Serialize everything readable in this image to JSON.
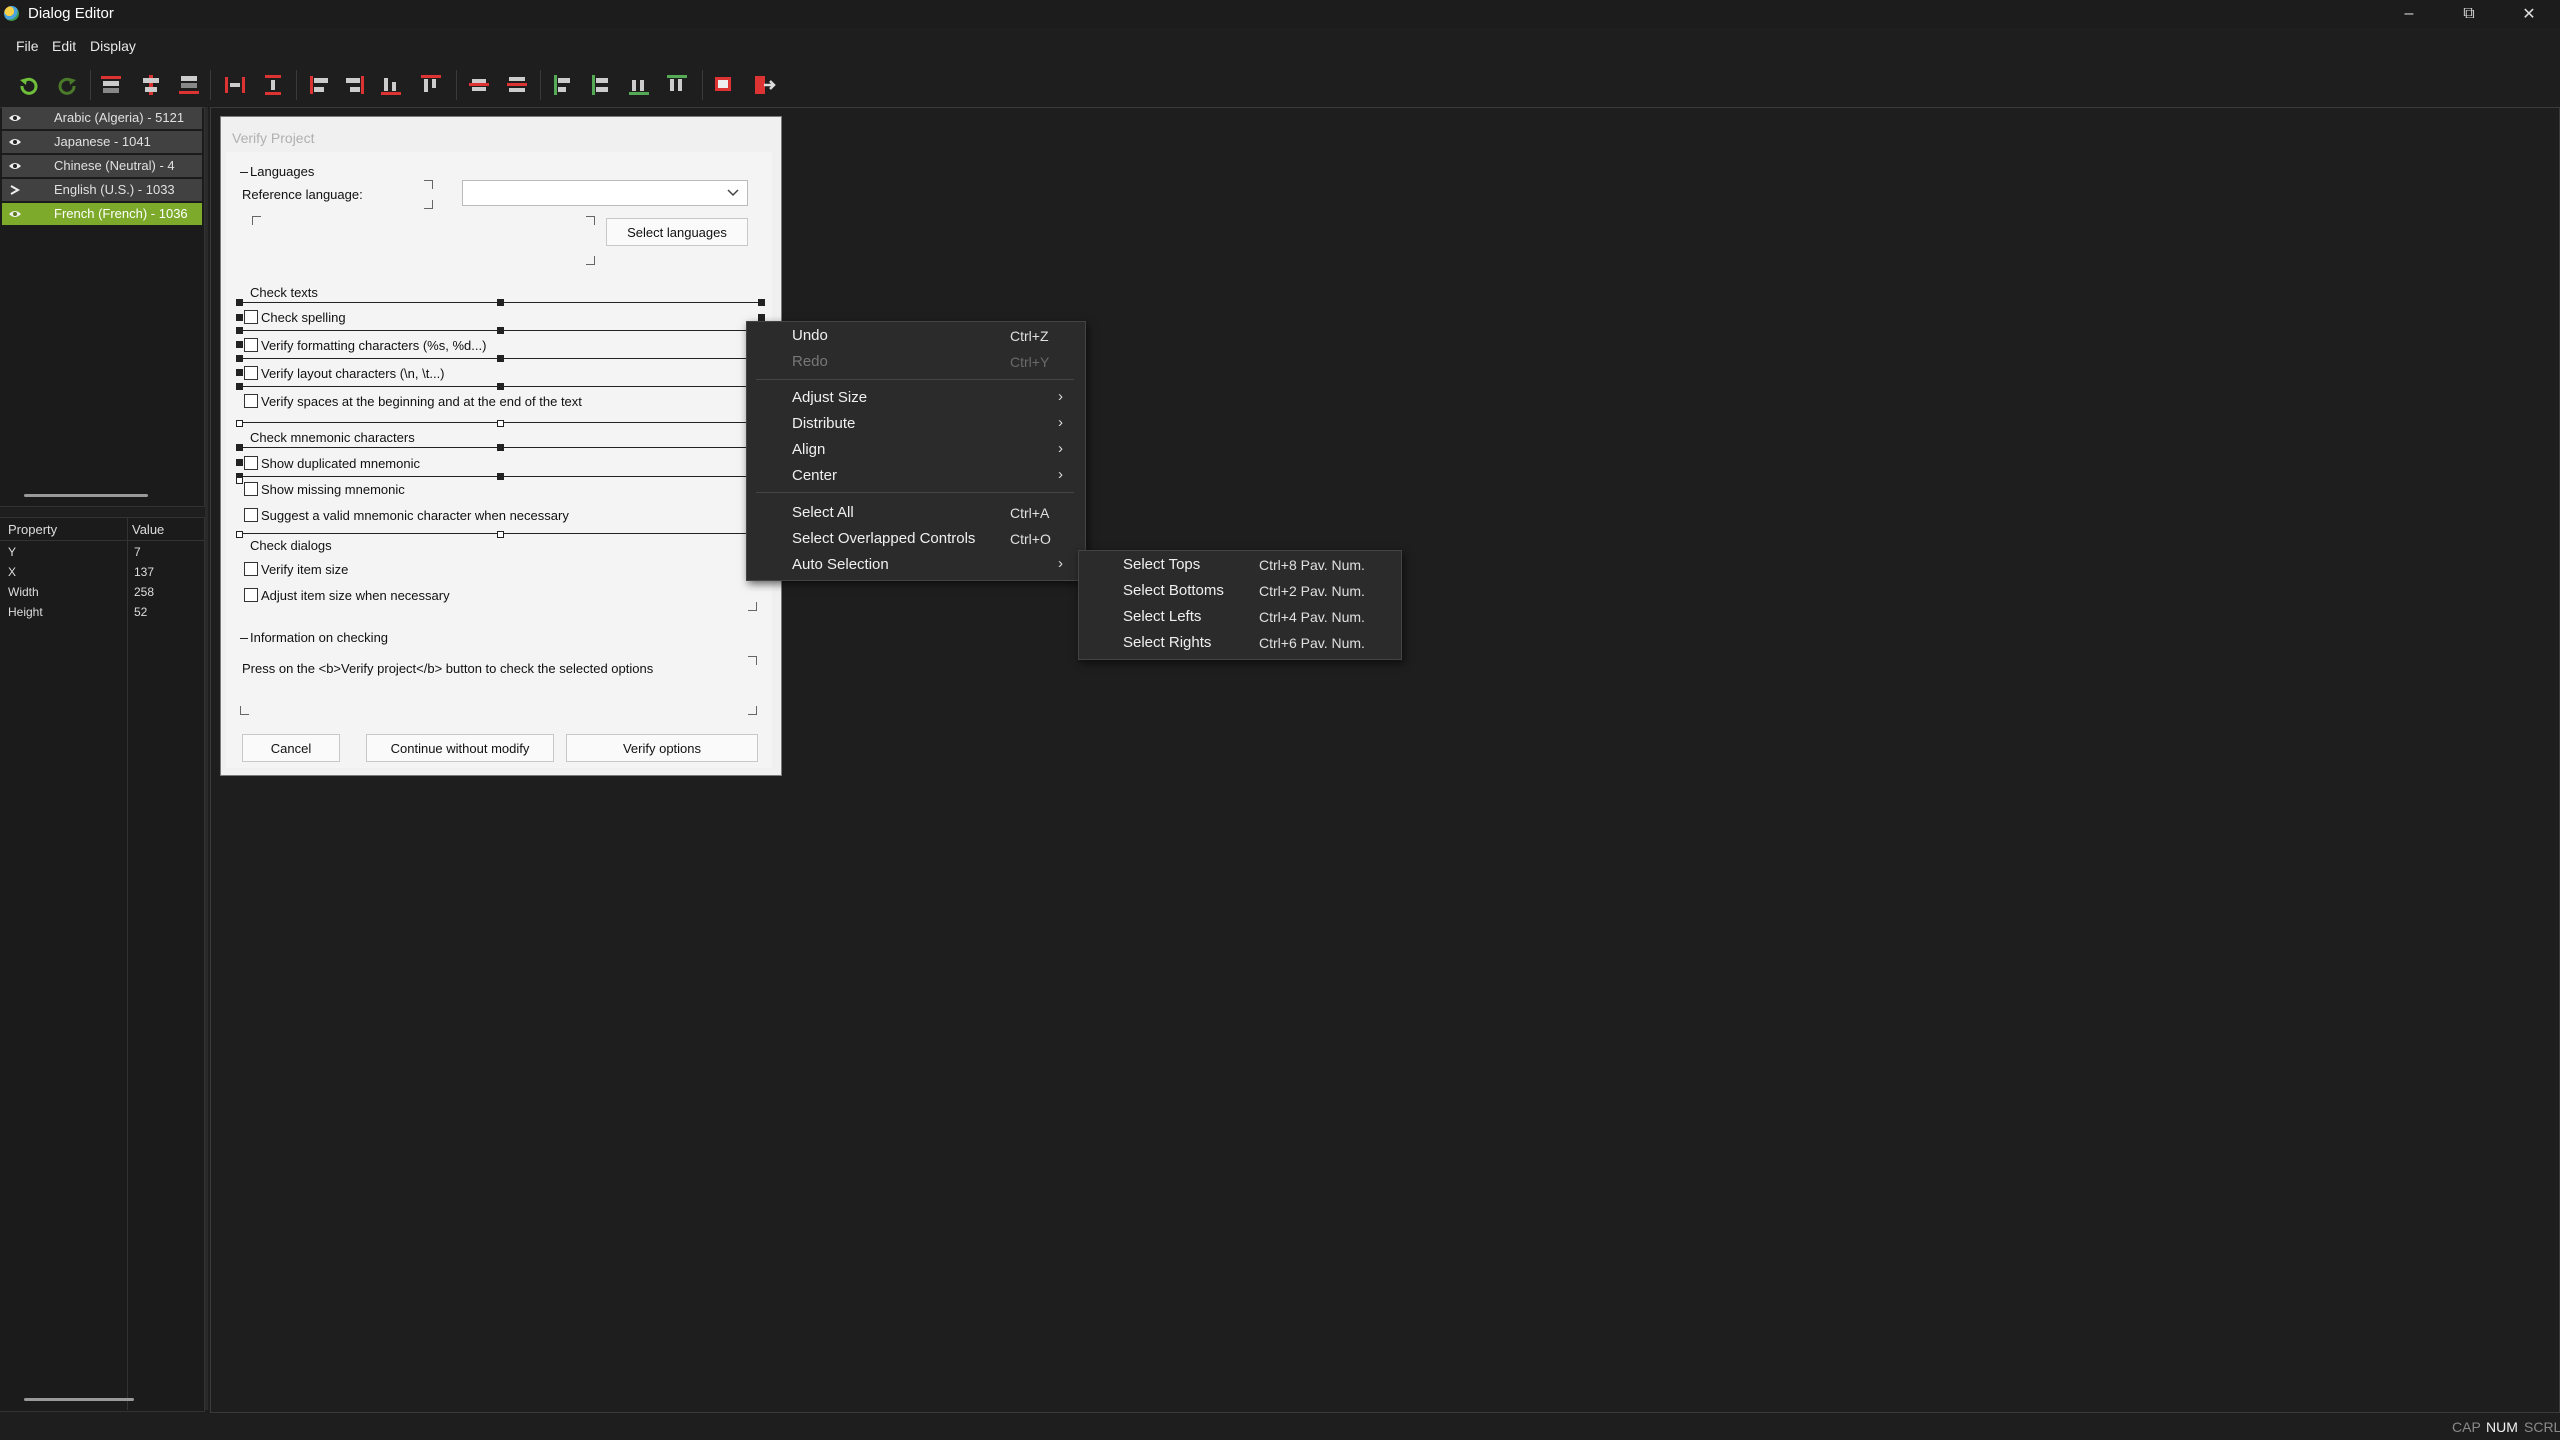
{
  "window": {
    "title": "Dialog Editor"
  },
  "menubar": [
    "File",
    "Edit",
    "Display"
  ],
  "languages": [
    {
      "label": "Arabic (Algeria) - 5121",
      "selected": false
    },
    {
      "label": "Japanese - 1041",
      "selected": false
    },
    {
      "label": "Chinese (Neutral) - 4",
      "selected": false
    },
    {
      "label": "English (U.S.) - 1033",
      "selected": false
    },
    {
      "label": "French (French) - 1036",
      "selected": true
    }
  ],
  "properties": {
    "headers": [
      "Property",
      "Value"
    ],
    "rows": [
      {
        "name": "Y",
        "value": "7"
      },
      {
        "name": "X",
        "value": "137"
      },
      {
        "name": "Width",
        "value": "258"
      },
      {
        "name": "Height",
        "value": "52"
      }
    ]
  },
  "dialog": {
    "title": "Verify Project",
    "languages_group": "Languages",
    "reference_language_label": "Reference language:",
    "reference_language_value": "",
    "select_languages_button": "Select languages",
    "check_texts_group": "Check texts",
    "check_spelling": "Check spelling",
    "verify_formatting": "Verify formatting characters (%s, %d...)",
    "verify_layout": "Verify layout characters (\\n, \\t...)",
    "verify_spaces": "Verify spaces at the beginning and at the end of the text",
    "check_mnemonic_group": "Check mnemonic characters",
    "show_duplicated": "Show duplicated mnemonic",
    "show_missing": "Show missing mnemonic",
    "suggest_valid": "Suggest a valid mnemonic character when necessary",
    "check_dialogs_group": "Check dialogs",
    "verify_item_size": "Verify item size",
    "adjust_item_size": "Adjust item size when necessary",
    "info_group": "Information on checking",
    "info_text": "Press on the <b>Verify project</b> button to check the selected options",
    "cancel_button": "Cancel",
    "continue_button": "Continue without modify",
    "verify_options_button": "Verify options"
  },
  "context_menu": {
    "undo": {
      "label": "Undo",
      "shortcut": "Ctrl+Z"
    },
    "redo": {
      "label": "Redo",
      "shortcut": "Ctrl+Y"
    },
    "adjust_size": "Adjust Size",
    "distribute": "Distribute",
    "align": "Align",
    "center": "Center",
    "select_all": {
      "label": "Select All",
      "shortcut": "Ctrl+A"
    },
    "select_overlapped": {
      "label": "Select Overlapped Controls",
      "shortcut": "Ctrl+O"
    },
    "auto_selection": "Auto Selection"
  },
  "submenu": [
    {
      "label": "Select Tops",
      "shortcut": "Ctrl+8 Pav. Num."
    },
    {
      "label": "Select Bottoms",
      "shortcut": "Ctrl+2 Pav. Num."
    },
    {
      "label": "Select Lefts",
      "shortcut": "Ctrl+4 Pav. Num."
    },
    {
      "label": "Select Rights",
      "shortcut": "Ctrl+6 Pav. Num."
    }
  ],
  "statusbar": {
    "cap": "CAP",
    "num": "NUM",
    "scrl": "SCRL"
  },
  "colors": {
    "selected_language": "#7daa2a",
    "background": "#1e1e1e",
    "menu": "#2b2b2b"
  }
}
